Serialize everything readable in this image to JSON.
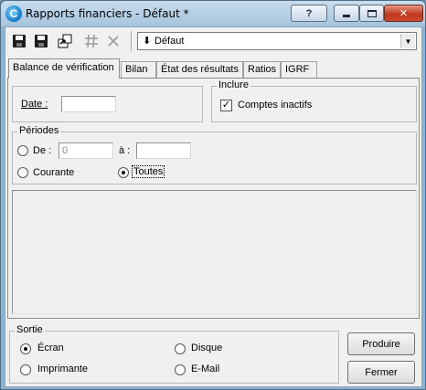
{
  "window": {
    "title": "Rapports financiers - Défaut *",
    "controls": {
      "help": "?",
      "close": "✕"
    }
  },
  "toolbar": {
    "profile_combo": {
      "value": "Défaut"
    },
    "icons": [
      "save-icon",
      "save-as-icon",
      "export-icon",
      "number-settings-icon",
      "delete-icon"
    ]
  },
  "tabs": [
    {
      "label": "Balance de vérification",
      "active": true
    },
    {
      "label": "Bilan"
    },
    {
      "label": "État des résultats"
    },
    {
      "label": "Ratios"
    },
    {
      "label": "IGRF"
    }
  ],
  "date_group": {
    "label": "Date :",
    "value": ""
  },
  "include_group": {
    "title": "Inclure",
    "inactive_accounts": {
      "label": "Comptes inactifs",
      "checked": true
    }
  },
  "periods_group": {
    "title": "Périodes",
    "from_label": "De :",
    "from_value": "0",
    "to_label": "à :",
    "to_value": "",
    "current_label": "Courante",
    "all_label": "Toutes",
    "selected": "Toutes"
  },
  "output_group": {
    "title": "Sortie",
    "screen": "Écran",
    "disk": "Disque",
    "printer": "Imprimante",
    "email": "E-Mail",
    "selected": "Écran"
  },
  "buttons": {
    "produce": "Produire",
    "close": "Fermer"
  },
  "colors": {
    "window_frame": "#8fb2cf",
    "client_bg": "#f0f0f0",
    "close_button": "#c2391e"
  }
}
